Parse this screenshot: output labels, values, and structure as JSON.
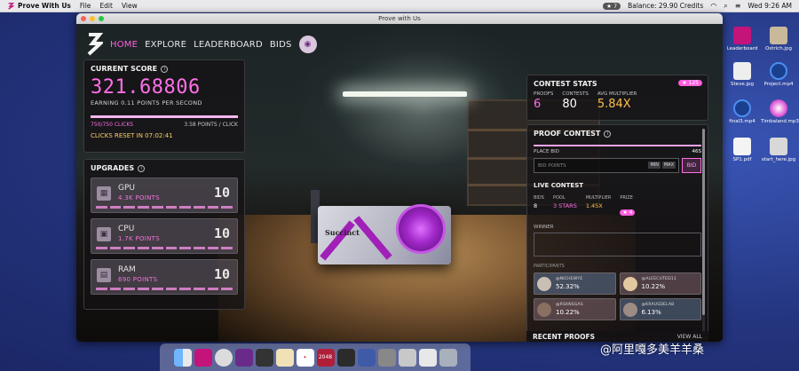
{
  "menubar": {
    "app_name": "Prove With Us",
    "menus": [
      "File",
      "Edit",
      "View"
    ],
    "badge_count": "7",
    "balance": "Balance: 29.90 Credits",
    "clock": "Wed 9:26 AM"
  },
  "window": {
    "title": "Prove with Us"
  },
  "nav": {
    "items": [
      "HOME",
      "EXPLORE",
      "LEADERBOARD",
      "BIDS"
    ]
  },
  "score": {
    "title": "CURRENT SCORE",
    "value": "321.68806",
    "rate": "EARNING 0.11 POINTS PER SECOND",
    "clicks": "750/750 CLICKS",
    "per_click": "3.58 POINTS / CLICK",
    "progress": 1.0,
    "reset": "CLICKS RESET IN 07:02:41"
  },
  "upgrades": {
    "title": "UPGRADES",
    "items": [
      {
        "name": "GPU",
        "points": "4.3K POINTS",
        "level": "10"
      },
      {
        "name": "CPU",
        "points": "1.7K POINTS",
        "level": "10"
      },
      {
        "name": "RAM",
        "points": "690 POINTS",
        "level": "10"
      }
    ]
  },
  "contest_stats": {
    "title": "CONTEST STATS",
    "star_badge": "★ 125",
    "proofs_label": "PROOFS",
    "proofs": "6",
    "contests_label": "CONTESTS",
    "contests": "80",
    "multiplier_label": "AVG MULTIPLIER",
    "multiplier": "5.84X"
  },
  "proof_contest": {
    "title": "PROOF CONTEST",
    "place_bid_label": "PLACE BID",
    "timer": "46S",
    "bid_placeholder": "BID POINTS",
    "min_label": "MIN",
    "max_label": "MAX",
    "bid_button": "BID",
    "live_title": "LIVE CONTEST",
    "bids_label": "BIDS",
    "bids": "8",
    "pool_label": "POOL",
    "pool": "3 STARS",
    "multiplier_label": "MULTIPLIER",
    "multiplier": "1.45X",
    "prize_label": "PRIZE",
    "prize": "★ 4",
    "winner_label": "WINNER",
    "participants_label": "PARTICIPANTS",
    "participants": [
      {
        "name": "@NICHEWYE",
        "pct": "52.32%"
      },
      {
        "name": "@ALEECUTED11",
        "pct": "10.22%"
      },
      {
        "name": "@RSKNSGAS",
        "pct": "10.22%"
      },
      {
        "name": "@KRAUSDELAB",
        "pct": "6.13%"
      }
    ]
  },
  "recent": {
    "title": "RECENT PROOFS",
    "view_all": "VIEW ALL"
  },
  "scene": {
    "gpu_brand": "Succinct"
  },
  "desktop_icons": [
    {
      "label": "Leaderboard"
    },
    {
      "label": "Ostrich.jpg"
    },
    {
      "label": "Steve.jpg"
    },
    {
      "label": "Project.mp4"
    },
    {
      "label": "final3.mp4"
    },
    {
      "label": "Timbaland.mp3"
    },
    {
      "label": "SP1.pdf"
    },
    {
      "label": "start_here.jpg"
    }
  ],
  "dock": {
    "apps": [
      "finder",
      "prove",
      "safari",
      "prove-2",
      "photos",
      "notes",
      "calendar",
      "tarot",
      "2048",
      "misc",
      "store",
      "settings",
      "photos-2",
      "trash"
    ],
    "calendar_label": "2048"
  },
  "watermark": "@阿里嘎多美羊羊桑",
  "colors": {
    "accent": "#ff6fe6",
    "gold": "#ffc04a",
    "panel": "#141214"
  }
}
